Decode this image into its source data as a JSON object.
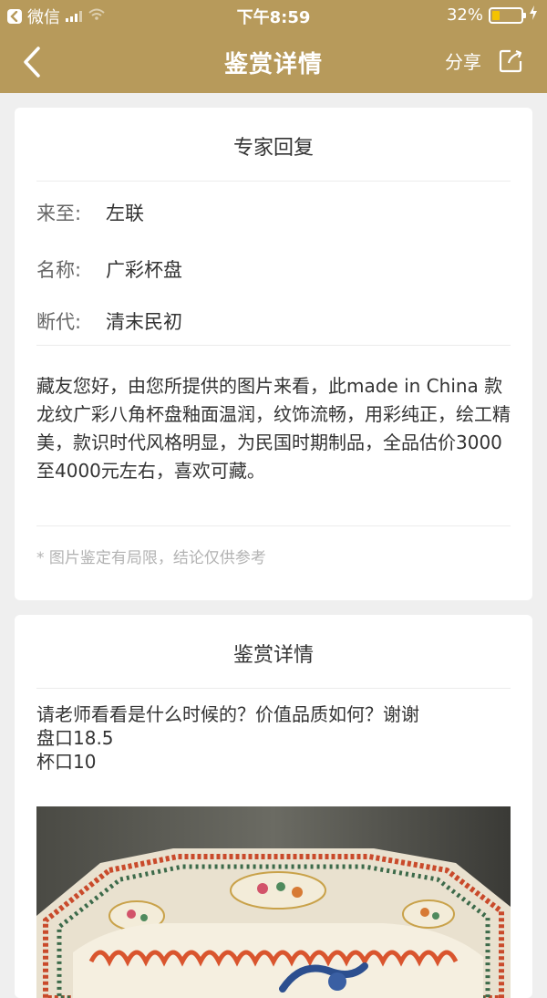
{
  "status_bar": {
    "carrier": "微信",
    "time": "下午8:59",
    "battery": "32%",
    "battery_level": 0.32
  },
  "nav": {
    "title": "鉴赏详情",
    "share_label": "分享",
    "back_icon": "chevron-left-icon",
    "share_icon": "share-icon"
  },
  "expert_card": {
    "title": "专家回复",
    "fields": [
      {
        "label": "来至:",
        "value": "左联"
      },
      {
        "label": "名称:",
        "value": "广彩杯盘"
      },
      {
        "label": "断代:",
        "value": "清末民初"
      }
    ],
    "reply": "藏友您好，由您所提供的图片来看，此made in China 款龙纹广彩八角杯盘釉面温润，纹饰流畅，用彩纯正，绘工精美，款识时代风格明显，为民国时期制品，全品估价3000至4000元左右，喜欢可藏。",
    "note": "* 图片鉴定有局限，结论仅供参考"
  },
  "detail_card": {
    "title": "鉴赏详情",
    "question_lines": [
      "请老师看看是什么时候的？价值品质如何？谢谢",
      "盘口18.5",
      "杯口10"
    ]
  },
  "colors": {
    "header": "#b79a5b",
    "background": "#efefef",
    "card": "#ffffff",
    "note": "#b3b3b3"
  }
}
